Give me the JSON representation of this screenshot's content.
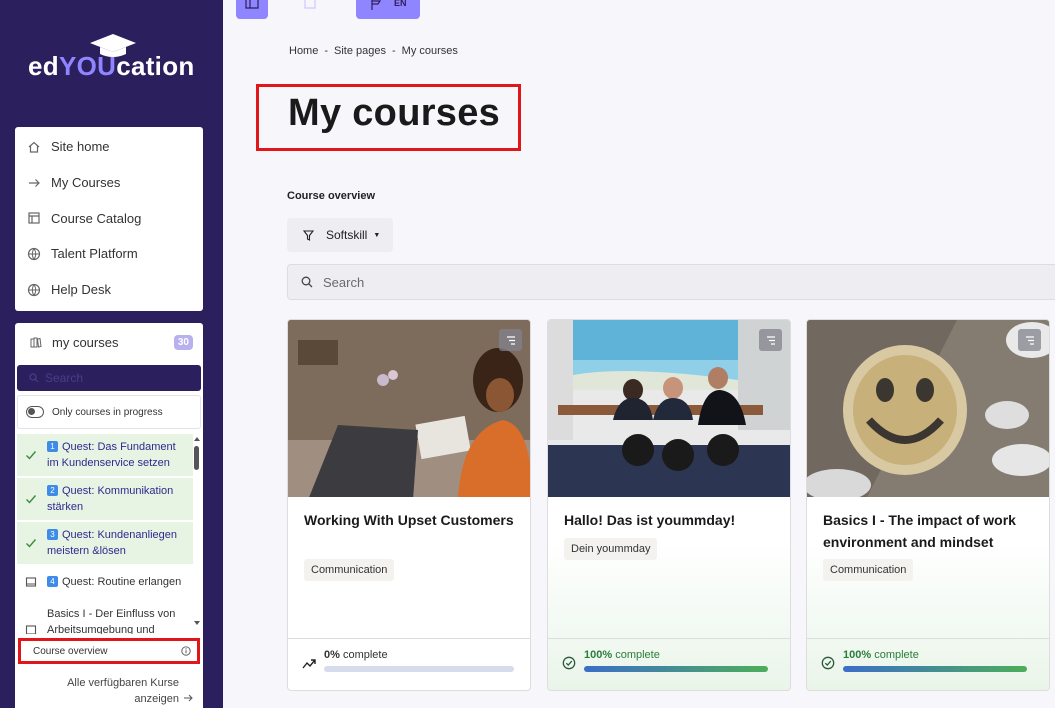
{
  "app": {
    "brand": "edYOUcation",
    "brand_pre": "ed",
    "brand_mid": "YOU",
    "brand_post": "cation",
    "lang": "EN"
  },
  "colors": {
    "sidebar": "#2c1f5e",
    "accent": "#8f85ff",
    "highlight_box": "#e0161b",
    "success": "#2a7d3b"
  },
  "nav": {
    "items": [
      {
        "label": "Site home",
        "icon": "home-icon"
      },
      {
        "label": "My Courses",
        "icon": "arrow-right-icon"
      },
      {
        "label": "Course Catalog",
        "icon": "catalog-icon"
      },
      {
        "label": "Talent Platform",
        "icon": "globe-icon"
      },
      {
        "label": "Help Desk",
        "icon": "globe-icon"
      }
    ]
  },
  "mycourses": {
    "title": "my courses",
    "count": "30",
    "search_placeholder": "Search",
    "toggle_label": "Only courses in progress",
    "items": [
      {
        "num": "1",
        "label": "Quest: Das Fundament im Kundenservice setzen",
        "done": true
      },
      {
        "num": "2",
        "label": "Quest: Kommunikation stärken",
        "done": true
      },
      {
        "num": "3",
        "label": "Quest: Kundenanliegen meistern &lösen",
        "done": true
      },
      {
        "num": "4",
        "label": "Quest: Routine erlangen",
        "done": false
      },
      {
        "num": "",
        "label": "Basics I - Der Einfluss von Arbeitsumgebung und",
        "done": false
      }
    ],
    "overview_link": "Course overview",
    "all_link_line1": "Alle verfügbaren Kurse",
    "all_link_line2": "anzeigen"
  },
  "breadcrumb": {
    "home": "Home",
    "site": "Site pages",
    "current": "My courses",
    "sep": "-"
  },
  "main": {
    "title": "My courses",
    "overview_label": "Course overview",
    "filter_label": "Softskill",
    "search_placeholder": "Search"
  },
  "courses": [
    {
      "title": "Working With Upset Customers",
      "tag": "Communication",
      "progress": 0,
      "pct_label": "0%",
      "complete_word": "complete"
    },
    {
      "title": "Hallo! Das ist yoummday!",
      "tag": "Dein yoummday",
      "progress": 100,
      "pct_label": "100%",
      "complete_word": "complete"
    },
    {
      "title": "Basics I - The impact of work environment and mindset",
      "tag": "Communication",
      "progress": 100,
      "pct_label": "100%",
      "complete_word": "complete"
    }
  ]
}
